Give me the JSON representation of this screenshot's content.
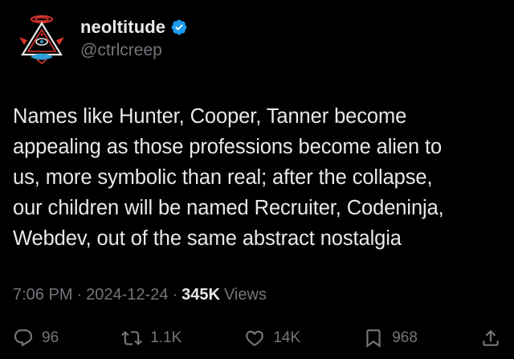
{
  "author": {
    "display_name": "neoltitude",
    "handle": "@ctrlcreep",
    "avatar_icon": "geometric-emblem-icon",
    "verified_icon": "verified-badge-icon",
    "verified_color": "#1d9bf0"
  },
  "post": {
    "text": "Names like Hunter, Cooper, Tanner become\nappealing as those professions become alien to\nus, more symbolic than real; after the collapse,\nour children will be named Recruiter, Codeninja,\nWebdev, out of the same abstract nostalgia"
  },
  "meta": {
    "time": "7:06 PM",
    "separator": "·",
    "date": "2024-12-24",
    "views_count": "345K",
    "views_label": "Views"
  },
  "actions": {
    "replies": {
      "icon": "reply-icon",
      "count": "96"
    },
    "reposts": {
      "icon": "repost-icon",
      "count": "1.1K"
    },
    "likes": {
      "icon": "like-icon",
      "count": "14K"
    },
    "bookmarks": {
      "icon": "bookmark-icon",
      "count": "968"
    },
    "share": {
      "icon": "share-icon"
    }
  },
  "colors": {
    "background": "#000000",
    "primary_text": "#e7e9ea",
    "secondary_text": "#71767b",
    "avatar_red": "#d9352b",
    "avatar_blue": "#2f9fd6"
  }
}
